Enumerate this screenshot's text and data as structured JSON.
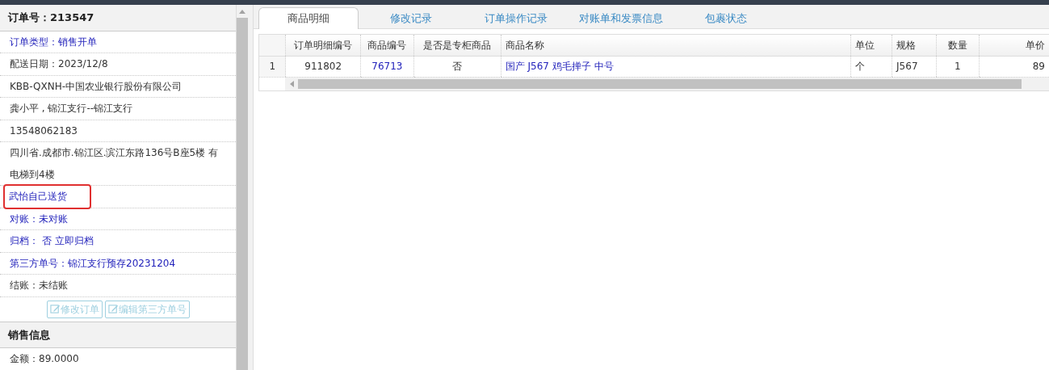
{
  "order_panel": {
    "title": "订单号：213547",
    "items": [
      {
        "text": "订单类型：销售开单",
        "kind": "link",
        "highlighted": false
      },
      {
        "text": "配送日期：2023/12/8",
        "kind": "text",
        "highlighted": false
      },
      {
        "text": "KBB-QXNH-中国农业银行股份有限公司",
        "kind": "text",
        "highlighted": false
      },
      {
        "text": "龚小平 , 锦江支行--锦江支行",
        "kind": "text",
        "highlighted": false
      },
      {
        "text": "13548062183",
        "kind": "text",
        "highlighted": false
      },
      {
        "text": "四川省.成都市.锦江区.滨江东路136号B座5楼 有电梯到4楼",
        "kind": "text",
        "highlighted": false
      },
      {
        "text": "武怡自己送货",
        "kind": "link",
        "highlighted": true
      },
      {
        "text": "对账：未对账",
        "kind": "link",
        "highlighted": false
      },
      {
        "text": "归档： 否 立即归档",
        "kind": "link",
        "highlighted": false
      },
      {
        "text": "第三方单号：锦江支行预存20231204",
        "kind": "link",
        "highlighted": false
      },
      {
        "text": "结账：未结账",
        "kind": "text",
        "highlighted": false
      }
    ],
    "buttons": [
      {
        "label": "修改订单",
        "disabled": true
      },
      {
        "label": "编辑第三方单号",
        "disabled": true
      }
    ]
  },
  "sales_panel": {
    "title": "销售信息",
    "items": [
      "金额：89.0000"
    ]
  },
  "tabs": [
    {
      "label": "商品明细",
      "selected": true
    },
    {
      "label": "修改记录",
      "selected": false
    },
    {
      "label": "订单操作记录",
      "selected": false
    },
    {
      "label": "对账单和发票信息",
      "selected": false
    },
    {
      "label": "包裹状态",
      "selected": false
    }
  ],
  "table": {
    "columns": [
      {
        "label": "订单明细编号"
      },
      {
        "label": "商品编号"
      },
      {
        "label": "是否是专柜商品"
      },
      {
        "label": "商品名称"
      },
      {
        "label": "单位"
      },
      {
        "label": "规格"
      },
      {
        "label": "数量"
      },
      {
        "label": "单价"
      }
    ],
    "rows": [
      {
        "row_number": "1",
        "cells": [
          {
            "text": "911802",
            "kind": "text"
          },
          {
            "text": "76713",
            "kind": "link"
          },
          {
            "text": "否",
            "kind": "text"
          },
          {
            "text": "国产 J567 鸡毛掸子 中号",
            "kind": "link"
          },
          {
            "text": "个",
            "kind": "text"
          },
          {
            "text": "J567",
            "kind": "text"
          },
          {
            "text": "1",
            "kind": "text"
          },
          {
            "text": "89",
            "kind": "text"
          }
        ]
      }
    ]
  }
}
